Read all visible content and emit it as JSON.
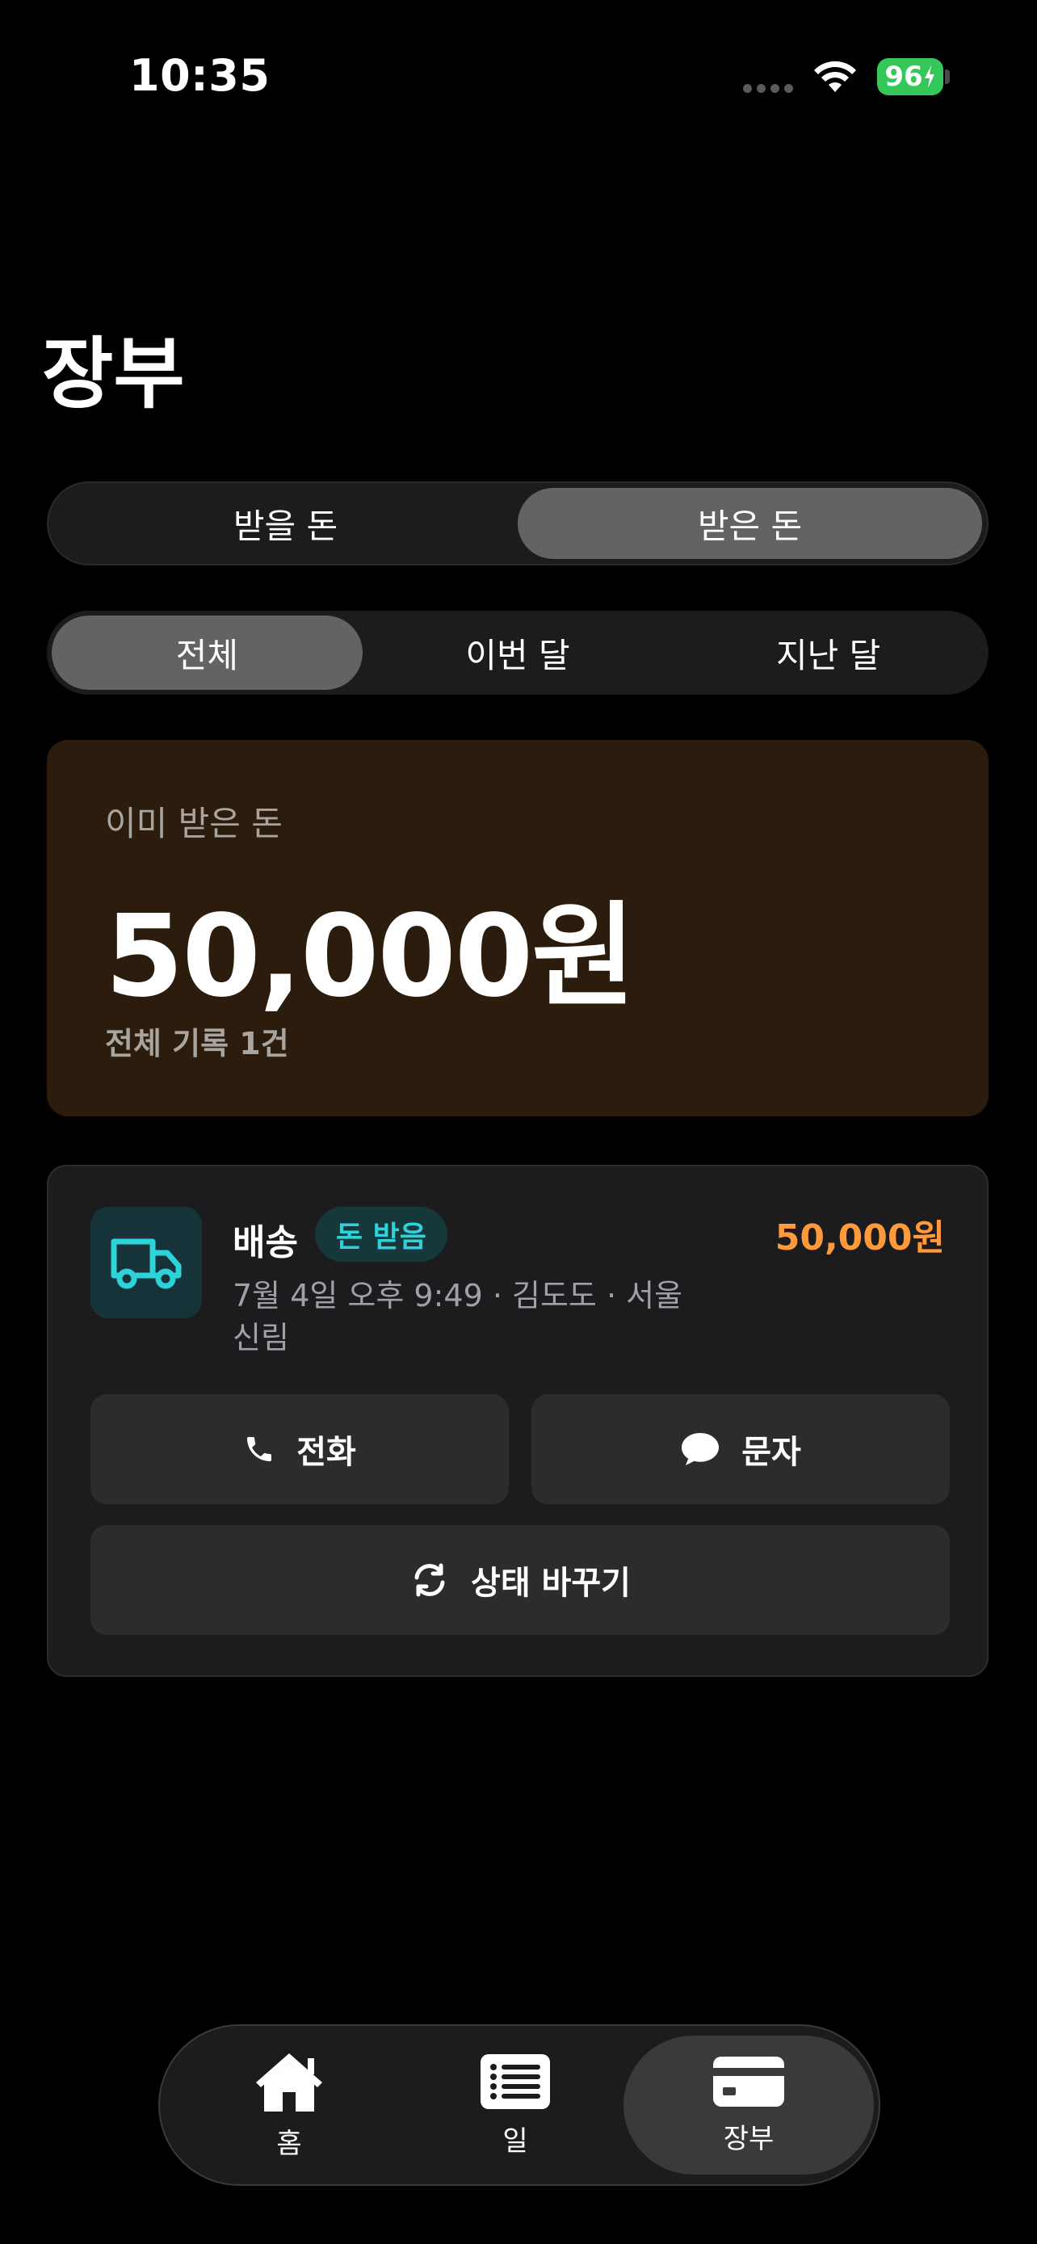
{
  "status_bar": {
    "time": "10:35",
    "battery": "96"
  },
  "page": {
    "title": "장부"
  },
  "money_toggle": {
    "options": [
      "받을 돈",
      "받은 돈"
    ],
    "selected": "받은 돈"
  },
  "period_filter": {
    "options": [
      "전체",
      "이번 달",
      "지난 달"
    ],
    "selected": "전체"
  },
  "summary": {
    "label": "이미 받은 돈",
    "amount": "50,000원",
    "count_text": "전체 기록 1건"
  },
  "records": [
    {
      "icon": "truck-icon",
      "title": "배송",
      "badge": "돈 받음",
      "amount": "50,000원",
      "meta": "7월 4일 오후 9:49 · 김도도 · 서울 신림",
      "actions": {
        "call": "전화",
        "sms": "문자",
        "change_status": "상태 바꾸기"
      }
    }
  ],
  "tab_bar": {
    "items": [
      {
        "label": "홈",
        "icon": "home-icon"
      },
      {
        "label": "일",
        "icon": "list-icon"
      },
      {
        "label": "장부",
        "icon": "card-icon"
      }
    ],
    "selected": "장부"
  },
  "colors": {
    "accent_amount": "#ff9a3c",
    "badge_text": "#2ed3d9",
    "truck_icon": "#2ed3d9",
    "summary_bg": "#2c1c0e",
    "battery": "#34c759"
  }
}
